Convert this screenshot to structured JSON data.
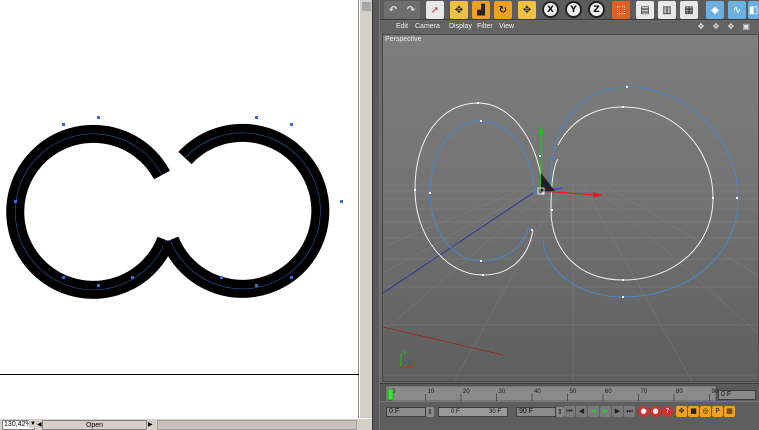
{
  "illustrator": {
    "zoom_value": "130,42%",
    "status_label": "Open"
  },
  "c4d": {
    "menu": [
      "Edit",
      "Camera",
      "Display",
      "Filter",
      "View"
    ],
    "viewport_label": "Perspective",
    "axis_buttons": [
      "X",
      "Y",
      "Z"
    ],
    "timeline_ticks": [
      "0",
      "10",
      "20",
      "30",
      "40",
      "50",
      "60",
      "70",
      "80",
      "90"
    ],
    "start_frame": "0 F",
    "end_frame": "90 F",
    "current_frame": "0 F",
    "mini_frame": "30 F",
    "right_frame": "0 F",
    "vp_icons": "✥ ✥ ✥ ▣"
  },
  "colors": {
    "ai_stroke": "#000000",
    "spline_blue": "#3a7ad0",
    "spline_white": "#f4f4f4",
    "axis_red": "#e02020",
    "axis_green": "#20c020",
    "axis_blue": "#2050e0"
  }
}
